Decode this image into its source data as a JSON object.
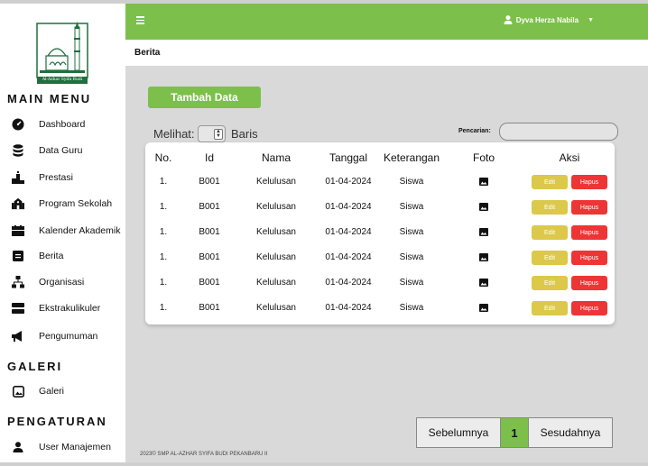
{
  "logo_text": "Al-Azhar Syifa Budi",
  "sidebar": {
    "sections": [
      {
        "title": "MAIN MENU"
      },
      {
        "title": "GALERI"
      },
      {
        "title": "PENGATURAN"
      }
    ],
    "items": [
      {
        "label": "Dashboard",
        "icon": "dashboard-icon"
      },
      {
        "label": "Data Guru",
        "icon": "database-icon"
      },
      {
        "label": "Prestasi",
        "icon": "podium-icon"
      },
      {
        "label": "Program Sekolah",
        "icon": "school-icon"
      },
      {
        "label": "Kalender Akademik",
        "icon": "calendar-icon"
      },
      {
        "label": "Berita",
        "icon": "news-icon"
      },
      {
        "label": "Organisasi",
        "icon": "org-chart-icon"
      },
      {
        "label": "Ekstrakulikuler",
        "icon": "activity-icon"
      },
      {
        "label": "Pengumuman",
        "icon": "megaphone-icon"
      },
      {
        "label": "Galeri",
        "icon": "image-icon"
      },
      {
        "label": "User Manajemen",
        "icon": "user-icon"
      }
    ]
  },
  "topbar": {
    "user_name": "Dyva Herza Nabila",
    "accent": "#7cc04b"
  },
  "breadcrumb": {
    "title": "Berita"
  },
  "content": {
    "add_button": "Tambah Data",
    "show_label": "Melihat:",
    "rows_label": "Baris",
    "search_label": "Pencarian:",
    "search_placeholder": ""
  },
  "table": {
    "headers": [
      "No.",
      "Id",
      "Nama",
      "Tanggal",
      "Keterangan",
      "Foto",
      "Aksi"
    ],
    "rows": [
      {
        "no": "1.",
        "id": "B001",
        "nama": "Kelulusan",
        "tanggal": "01-04-2024",
        "keterangan": "Siswa"
      },
      {
        "no": "1.",
        "id": "B001",
        "nama": "Kelulusan",
        "tanggal": "01-04-2024",
        "keterangan": "Siswa"
      },
      {
        "no": "1.",
        "id": "B001",
        "nama": "Kelulusan",
        "tanggal": "01-04-2024",
        "keterangan": "Siswa"
      },
      {
        "no": "1.",
        "id": "B001",
        "nama": "Kelulusan",
        "tanggal": "01-04-2024",
        "keterangan": "Siswa"
      },
      {
        "no": "1.",
        "id": "B001",
        "nama": "Kelulusan",
        "tanggal": "01-04-2024",
        "keterangan": "Siswa"
      },
      {
        "no": "1.",
        "id": "B001",
        "nama": "Kelulusan",
        "tanggal": "01-04-2024",
        "keterangan": "Siswa"
      }
    ],
    "edit_label": "Edit",
    "delete_label": "Hapus",
    "edit_color": "#dcc84a",
    "delete_color": "#ee3535"
  },
  "pagination": {
    "prev": "Sebelumnya",
    "current": "1",
    "next": "Sesudahnya"
  },
  "footer": "2023© SMP AL-AZHAR SYIFA BUDI PEKANBARU II"
}
